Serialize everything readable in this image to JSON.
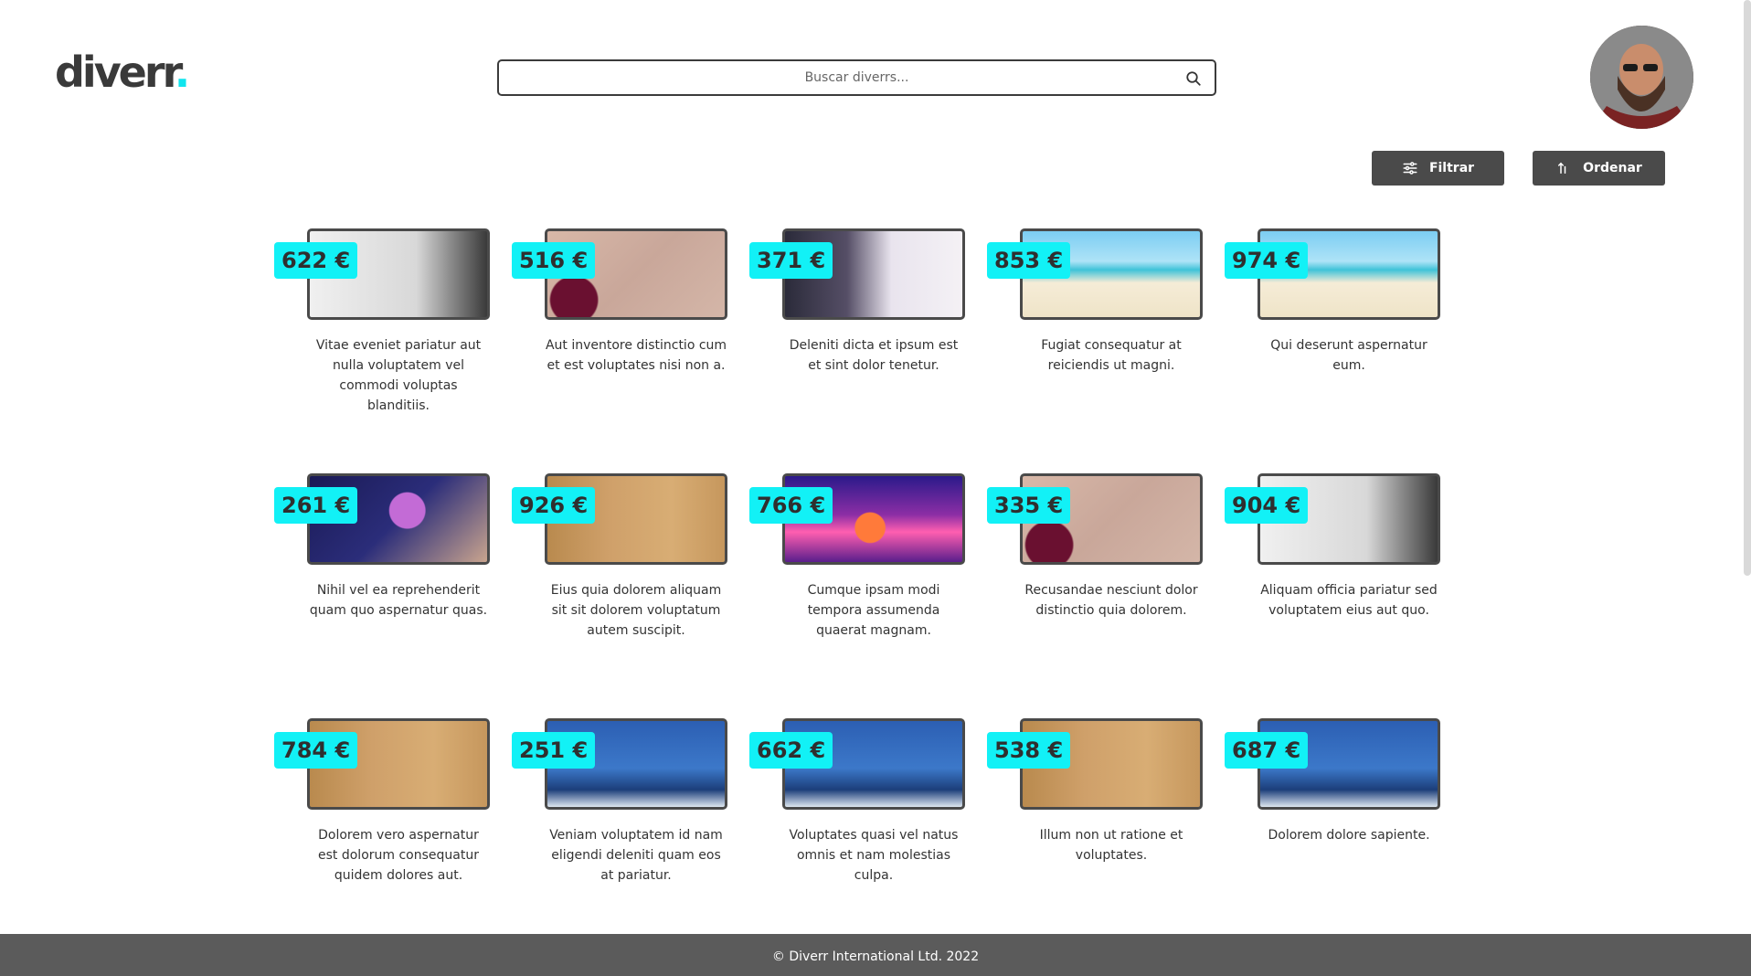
{
  "brand": {
    "name": "diverr",
    "dot": ".",
    "accent": "#11e5ee"
  },
  "search": {
    "placeholder": "Buscar diverrs...",
    "value": ""
  },
  "user": {
    "avatar_alt": "user avatar"
  },
  "toolbar": {
    "filter_label": "Filtrar",
    "order_label": "Ordenar"
  },
  "cards": [
    {
      "price": "622 €",
      "desc": "Vitae eveniet pariatur aut nulla voluptatem vel commodi voluptas blanditiis.",
      "image": "rope-athlete"
    },
    {
      "price": "516 €",
      "desc": "Aut inventore distinctio cum et est voluptates nisi non a.",
      "image": "floral"
    },
    {
      "price": "371 €",
      "desc": "Deleniti dicta et ipsum est et sint dolor tenetur.",
      "image": "laptop"
    },
    {
      "price": "853 €",
      "desc": "Fugiat consequatur at reiciendis ut magni.",
      "image": "beach-chairs"
    },
    {
      "price": "974 €",
      "desc": "Qui deserunt aspernatur eum.",
      "image": "beach-chairs"
    },
    {
      "price": "261 €",
      "desc": "Nihil vel ea reprehenderit quam quo aspernatur quas.",
      "image": "space-hands"
    },
    {
      "price": "926 €",
      "desc": "Eius quia dolorem aliquam sit sit dolorem voluptatum autem suscipit.",
      "image": "egypt-relief"
    },
    {
      "price": "766 €",
      "desc": "Cumque ipsam modi tempora assumenda quaerat magnam.",
      "image": "cocktail"
    },
    {
      "price": "335 €",
      "desc": "Recusandae nesciunt dolor distinctio quia dolorem.",
      "image": "floral"
    },
    {
      "price": "904 €",
      "desc": "Aliquam officia pariatur sed voluptatem eius aut quo.",
      "image": "rope-athlete"
    },
    {
      "price": "784 €",
      "desc": "Dolorem vero aspernatur est dolorum consequatur quidem dolores aut.",
      "image": "egypt-relief"
    },
    {
      "price": "251 €",
      "desc": "Veniam voluptatem id nam eligendi deleniti quam eos at pariatur.",
      "image": "cable-car"
    },
    {
      "price": "662 €",
      "desc": "Voluptates quasi vel natus omnis et nam molestias culpa.",
      "image": "cable-car"
    },
    {
      "price": "538 €",
      "desc": "Illum non ut ratione et voluptates.",
      "image": "egypt-relief"
    },
    {
      "price": "687 €",
      "desc": "Dolorem dolore sapiente.",
      "image": "cable-car"
    }
  ],
  "footer": {
    "text": "© Diverr International Ltd. 2022"
  }
}
